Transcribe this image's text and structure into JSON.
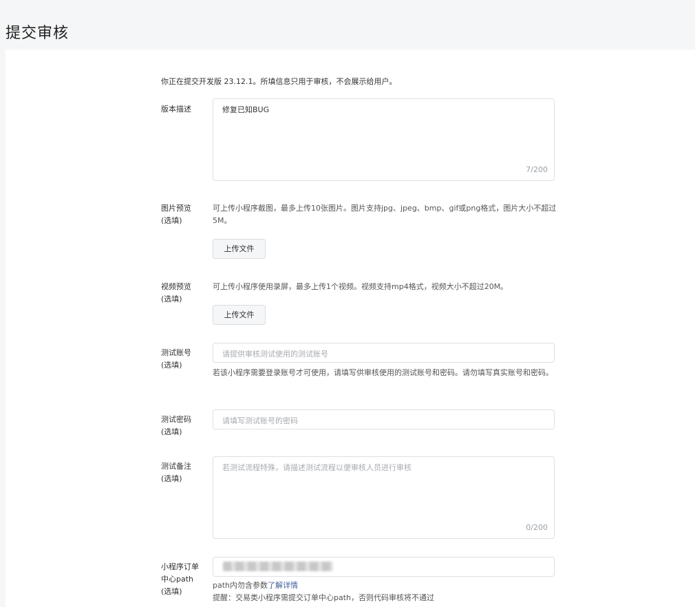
{
  "page": {
    "title": "提交审核"
  },
  "notice": "你正在提交开发版 23.12.1。所填信息只用于审核，不会展示给用户。",
  "version_desc": {
    "label": "版本描述",
    "value": "修复已知BUG",
    "counter": "7/200"
  },
  "image_preview": {
    "label": "图片预览",
    "optional": "(选填)",
    "help": "可上传小程序截图，最多上传10张图片。图片支持jpg、jpeg、bmp、gif或png格式，图片大小不超过5M。",
    "button": "上传文件"
  },
  "video_preview": {
    "label": "视频预览",
    "optional": "(选填)",
    "help": "可上传小程序使用录屏，最多上传1个视频。视频支持mp4格式，视频大小不超过20M。",
    "button": "上传文件"
  },
  "test_account": {
    "label": "测试账号",
    "optional": "(选填)",
    "placeholder": "请提供审核测试使用的测试账号",
    "help": "若该小程序需要登录账号才可使用，请填写供审核使用的测试账号和密码。请勿填写真实账号和密码。"
  },
  "test_password": {
    "label": "测试密码",
    "optional": "(选填)",
    "placeholder": "请填写测试账号的密码"
  },
  "test_notes": {
    "label": "测试备注",
    "optional": "(选填)",
    "placeholder": "若测试流程特殊，请描述测试流程以便审核人员进行审核",
    "counter": "0/200"
  },
  "order_path": {
    "label_line1": "小程序订单",
    "label_line2": "中心path",
    "optional": "(选填)",
    "help_prefix": "path内勿含参数",
    "help_link": "了解详情",
    "reminder": "提醒：交易类小程序需提交订单中心path，否则代码审核将不通过"
  }
}
